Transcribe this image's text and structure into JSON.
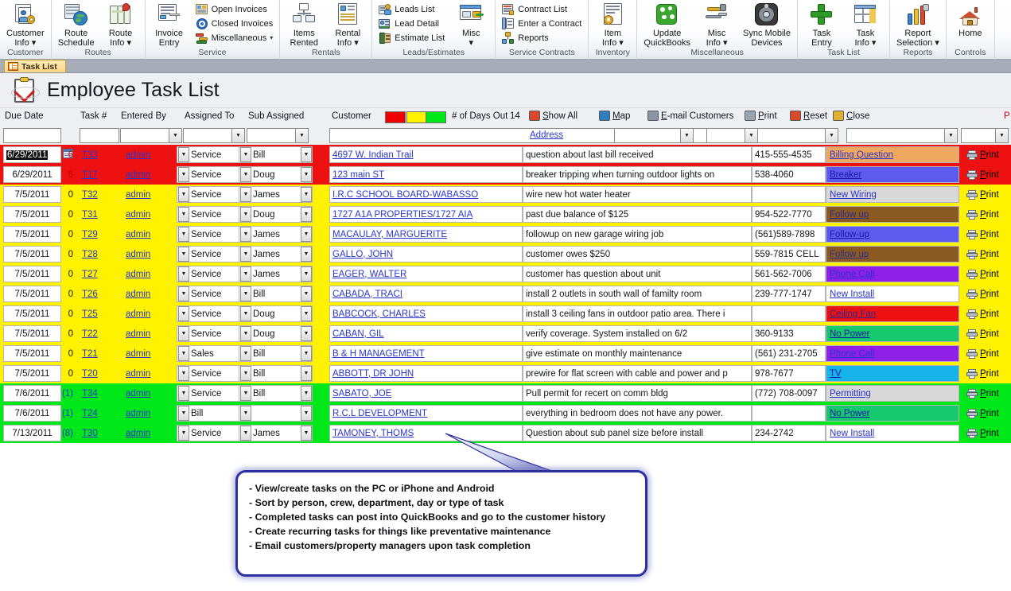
{
  "ribbon": {
    "groups": [
      {
        "title": "Customer",
        "big": [
          {
            "label": "Customer\nInfo ~",
            "icon": "customer-info-icon"
          }
        ],
        "small": []
      },
      {
        "title": "Routes",
        "big": [
          {
            "label": "Route\nSchedule",
            "icon": "route-schedule-icon"
          },
          {
            "label": "Route\nInfo ~",
            "icon": "route-info-icon"
          }
        ],
        "small": []
      },
      {
        "title": "Service",
        "big": [
          {
            "label": "Invoice\nEntry",
            "icon": "invoice-entry-icon"
          }
        ],
        "small": [
          {
            "label": "Open Invoices",
            "icon": "open-invoices-icon"
          },
          {
            "label": "Closed Invoices",
            "icon": "closed-invoices-icon"
          },
          {
            "label": "Miscellaneous",
            "icon": "miscellaneous-icon",
            "caret": true
          }
        ]
      },
      {
        "title": "Rentals",
        "big": [
          {
            "label": "Items\nRented",
            "icon": "items-rented-icon"
          },
          {
            "label": "Rental\nInfo ~",
            "icon": "rental-info-icon"
          }
        ],
        "small": []
      },
      {
        "title": "Leads/Estimates",
        "big": [
          {
            "label": "Misc\n~",
            "icon": "leads-misc-icon"
          }
        ],
        "small": [
          {
            "label": "Leads List",
            "icon": "leads-list-icon"
          },
          {
            "label": "Lead Detail",
            "icon": "lead-detail-icon"
          },
          {
            "label": "Estimate List",
            "icon": "estimate-list-icon"
          }
        ]
      },
      {
        "title": "Service Contracts",
        "big": [],
        "small": [
          {
            "label": "Contract List",
            "icon": "contract-list-icon"
          },
          {
            "label": "Enter a Contract",
            "icon": "enter-contract-icon"
          },
          {
            "label": "Reports",
            "icon": "reports-icon"
          }
        ]
      },
      {
        "title": "Inventory",
        "big": [
          {
            "label": "Item\nInfo ~",
            "icon": "item-info-icon"
          }
        ],
        "small": []
      },
      {
        "title": "Miscellaneous",
        "big": [
          {
            "label": "Update\nQuickBooks",
            "icon": "update-quickbooks-icon"
          },
          {
            "label": "Misc\nInfo ~",
            "icon": "misc-info-icon"
          },
          {
            "label": "Sync Mobile\nDevices",
            "icon": "sync-mobile-devices-icon"
          }
        ],
        "small": []
      },
      {
        "title": "Task List",
        "big": [
          {
            "label": "Task\nEntry",
            "icon": "task-entry-icon"
          },
          {
            "label": "Task\nInfo ~",
            "icon": "task-info-icon"
          }
        ],
        "small": []
      },
      {
        "title": "Reports",
        "big": [
          {
            "label": "Report\nSelection ~",
            "icon": "report-selection-icon"
          }
        ],
        "small": []
      },
      {
        "title": "Controls",
        "big": [
          {
            "label": "Home",
            "icon": "home-icon"
          }
        ],
        "small": []
      }
    ]
  },
  "doc_tab": {
    "label": "Task List",
    "icon": "table-view-icon"
  },
  "form": {
    "title": "Employee Task List",
    "icon": "clipboard-check-icon"
  },
  "columns": {
    "due_date": "Due Date",
    "task_no": "Task #",
    "entered_by": "Entered By",
    "assigned_to": "Assigned To",
    "sub_assigned": "Sub Assigned",
    "customer": "Customer",
    "days_out": "# of Days Out",
    "days_out_value": "14",
    "address_link": "Address"
  },
  "swatches": {
    "red": "#ee0000",
    "yellow": "#fff200",
    "green": "#00e819"
  },
  "toolbar": {
    "show_all": "Show All",
    "map": "Map",
    "email_customers": "E-mail Customers",
    "print": "Print",
    "reset": "Reset",
    "close": "Close",
    "edge_print": "P"
  },
  "row_print_label": "Print",
  "rows": [
    {
      "due_date": "6/29/2011",
      "days": "6",
      "days_color": "#cc0000",
      "task": "T33",
      "entered_by": "admin",
      "assigned_to": "Service",
      "sub_assigned": "Bill",
      "customer": "4697 W. Indian Trail",
      "description": "question about last bill received",
      "phone": "415-555-4535",
      "category": "Billing Question",
      "cat_bg": "#f0a860",
      "cat_fg": "#2a35c8",
      "band": "#ee1111",
      "selected": true,
      "has_picker": true
    },
    {
      "due_date": "6/29/2011",
      "days": "6",
      "days_color": "#cc0000",
      "task": "T17",
      "entered_by": "admin",
      "assigned_to": "Service",
      "sub_assigned": "Doug",
      "customer": "123 main ST",
      "description": "breaker tripping when turning outdoor lights on",
      "phone": "538-4060",
      "category": "Breaker",
      "cat_bg": "#5b5bf0",
      "cat_fg": "#1a1aa8",
      "band": "#ee1111",
      "selected": false,
      "has_picker": false
    },
    {
      "due_date": "7/5/2011",
      "days": "0",
      "days_color": "#14161a",
      "task": "T32",
      "entered_by": "admin",
      "assigned_to": "Service",
      "sub_assigned": "James",
      "customer": "I.R.C SCHOOL BOARD-WABASSO",
      "description": "wire new hot water heater",
      "phone": "",
      "category": "New Wiring",
      "cat_bg": "#d8d8d8",
      "cat_fg": "#2a35c8",
      "band": "#fff200",
      "selected": false,
      "has_picker": false
    },
    {
      "due_date": "7/5/2011",
      "days": "0",
      "days_color": "#14161a",
      "task": "T31",
      "entered_by": "admin",
      "assigned_to": "Service",
      "sub_assigned": "Doug",
      "customer": "1727 A1A PROPERTIES/1727 AIA",
      "description": "past due balance of $125",
      "phone": "954-522-7770",
      "category": "Follow up",
      "cat_bg": "#8a5a22",
      "cat_fg": "#2a2a90",
      "band": "#fff200",
      "selected": false,
      "has_picker": false
    },
    {
      "due_date": "7/5/2011",
      "days": "0",
      "days_color": "#14161a",
      "task": "T29",
      "entered_by": "admin",
      "assigned_to": "Service",
      "sub_assigned": "James",
      "customer": "MACAULAY, MARGUERITE",
      "description": "followup on new garage wiring job",
      "phone": "(561)589-7898",
      "category": "Follow-up",
      "cat_bg": "#5b5bf0",
      "cat_fg": "#1a1aa8",
      "band": "#fff200",
      "selected": false,
      "has_picker": false
    },
    {
      "due_date": "7/5/2011",
      "days": "0",
      "days_color": "#14161a",
      "task": "T28",
      "entered_by": "admin",
      "assigned_to": "Service",
      "sub_assigned": "James",
      "customer": "GALLO, JOHN",
      "description": "customer owes $250",
      "phone": "559-7815 CELL",
      "category": "Follow up",
      "cat_bg": "#8a5a22",
      "cat_fg": "#2a2a90",
      "band": "#fff200",
      "selected": false,
      "has_picker": false
    },
    {
      "due_date": "7/5/2011",
      "days": "0",
      "days_color": "#14161a",
      "task": "T27",
      "entered_by": "admin",
      "assigned_to": "Service",
      "sub_assigned": "James",
      "customer": "EAGER, WALTER",
      "description": "customer has question about unit",
      "phone": "561-562-7006",
      "category": "Phone Call",
      "cat_bg": "#9020e8",
      "cat_fg": "#2a35c8",
      "band": "#fff200",
      "selected": false,
      "has_picker": false
    },
    {
      "due_date": "7/5/2011",
      "days": "0",
      "days_color": "#14161a",
      "task": "T26",
      "entered_by": "admin",
      "assigned_to": "Service",
      "sub_assigned": "Bill",
      "customer": "CABADA, TRACI",
      "description": "install 2 outlets in south wall of familty room",
      "phone": "239-777-1747",
      "category": "New Install",
      "cat_bg": "#ffffff",
      "cat_fg": "#2a35c8",
      "band": "#fff200",
      "selected": false,
      "has_picker": false
    },
    {
      "due_date": "7/5/2011",
      "days": "0",
      "days_color": "#14161a",
      "task": "T25",
      "entered_by": "admin",
      "assigned_to": "Service",
      "sub_assigned": "Doug",
      "customer": "BABCOCK, CHARLES",
      "description": "install 3 ceiling fans in outdoor patio area.  There i",
      "phone": "",
      "category": "Ceiling Fan",
      "cat_bg": "#ee1111",
      "cat_fg": "#2a2a90",
      "band": "#fff200",
      "selected": false,
      "has_picker": false
    },
    {
      "due_date": "7/5/2011",
      "days": "0",
      "days_color": "#14161a",
      "task": "T22",
      "entered_by": "admin",
      "assigned_to": "Service",
      "sub_assigned": "Doug",
      "customer": "CABAN, GIL",
      "description": "verify coverage.  System installed on 6/2",
      "phone": "360-9133",
      "category": "No Power",
      "cat_bg": "#16c86e",
      "cat_fg": "#1a1aa8",
      "band": "#fff200",
      "selected": false,
      "has_picker": false
    },
    {
      "due_date": "7/5/2011",
      "days": "0",
      "days_color": "#14161a",
      "task": "T21",
      "entered_by": "admin",
      "assigned_to": "Sales",
      "sub_assigned": "Bill",
      "customer": "B & H MANAGEMENT",
      "description": "give estimate on monthly maintenance",
      "phone": "(561) 231-2705",
      "category": "Phone Call",
      "cat_bg": "#9020e8",
      "cat_fg": "#2a35c8",
      "band": "#fff200",
      "selected": false,
      "has_picker": false
    },
    {
      "due_date": "7/5/2011",
      "days": "0",
      "days_color": "#14161a",
      "task": "T20",
      "entered_by": "admin",
      "assigned_to": "Service",
      "sub_assigned": "Bill",
      "customer": "ABBOTT, DR JOHN",
      "description": "prewire for flat screen with cable and power and p",
      "phone": "978-7677",
      "category": "TV",
      "cat_bg": "#16b2ea",
      "cat_fg": "#1a1aa8",
      "band": "#fff200",
      "selected": false,
      "has_picker": false
    },
    {
      "due_date": "7/6/2011",
      "days": "(1)",
      "days_color": "#2a35c8",
      "task": "T34",
      "entered_by": "admin",
      "assigned_to": "Service",
      "sub_assigned": "Bill",
      "customer": "SABATO, JOE",
      "description": "Pull permit for recert on comm bldg",
      "phone": "(772) 708-0097",
      "category": "Permitting",
      "cat_bg": "#d8d8d8",
      "cat_fg": "#2a35c8",
      "band": "#00e819",
      "selected": false,
      "has_picker": false
    },
    {
      "due_date": "7/6/2011",
      "days": "(1)",
      "days_color": "#2a35c8",
      "task": "T24",
      "entered_by": "admin",
      "assigned_to": "Bill",
      "sub_assigned": "",
      "customer": "R.C.L DEVELOPMENT",
      "description": "everything in bedroom does not have any power.",
      "phone": "",
      "category": "No Power",
      "cat_bg": "#16c86e",
      "cat_fg": "#1a1aa8",
      "band": "#00e819",
      "selected": false,
      "has_picker": false
    },
    {
      "due_date": "7/13/2011",
      "days": "(8)",
      "days_color": "#2a35c8",
      "task": "T30",
      "entered_by": "admin",
      "assigned_to": "Service",
      "sub_assigned": "James",
      "customer": "TAMONEY, THOMS",
      "description": "Question about sub panel size before install",
      "phone": "234-2742",
      "category": "New Install",
      "cat_bg": "#ffffff",
      "cat_fg": "#2a35c8",
      "band": "#00e819",
      "selected": false,
      "has_picker": false
    }
  ],
  "callout": {
    "lines": [
      "- View/create tasks on the PC or iPhone and Android",
      "- Sort by person, crew, department, day or type of task",
      "- Completed tasks can post into QuickBooks and go to the customer history",
      "- Create recurring tasks for things like preventative maintenance",
      "- Email customers/property managers upon task completion"
    ]
  }
}
